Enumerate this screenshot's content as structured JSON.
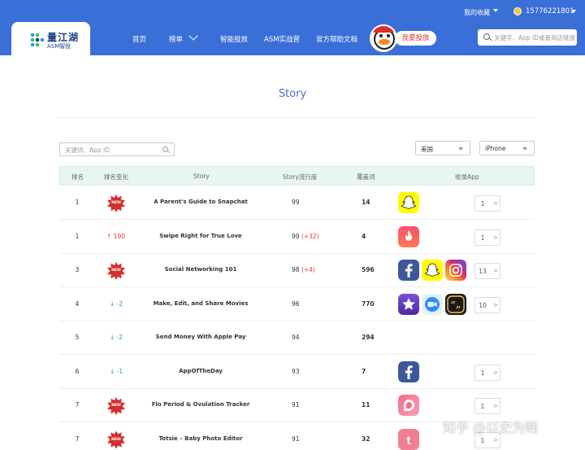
{
  "header": {
    "logo_name": "量江湖",
    "logo_sub": "ASM智投",
    "favorites": "我的收藏",
    "user_phone": "15776221801",
    "nav": [
      "首页",
      "榜单",
      "智能投放",
      "ASM实战营",
      "官方帮助文档"
    ],
    "promote_button": "我要投放",
    "search_placeholder": "关键字、App ID或者商店链接"
  },
  "page": {
    "title": "Story"
  },
  "filters": {
    "keyword_placeholder": "关键词、App ID",
    "country": "美国",
    "device": "iPhone"
  },
  "table": {
    "columns": [
      "排名",
      "排名变化",
      "Story",
      "Story流行度",
      "覆盖词",
      "收录App"
    ],
    "new_badge": "NEW",
    "rows": [
      {
        "rank": "1",
        "change": "new",
        "change_text": "",
        "story": "A Parent's Guide to Snapchat",
        "pop": "99",
        "pop_delta": "",
        "cover": "14",
        "apps": [
          "snapchat"
        ],
        "page": "1",
        "next": ">"
      },
      {
        "rank": "1",
        "change": "up",
        "change_text": "↑ 190",
        "story": "Swipe Right for True Love",
        "pop": "99",
        "pop_delta": "(+32)",
        "cover": "4",
        "apps": [
          "tinder"
        ],
        "page": "1",
        "next": ">"
      },
      {
        "rank": "3",
        "change": "new",
        "change_text": "",
        "story": "Social Networking 101",
        "pop": "98",
        "pop_delta": "(+4)",
        "cover": "596",
        "apps": [
          "facebook",
          "snapchat",
          "instagram"
        ],
        "page": "13",
        "next": ">"
      },
      {
        "rank": "4",
        "change": "down",
        "change_text": "↓ -2",
        "story": "Make, Edit, and Share Movies",
        "pop": "96",
        "pop_delta": "",
        "cover": "770",
        "apps": [
          "imovie",
          "zoom",
          "quotes"
        ],
        "page": "10",
        "next": ">"
      },
      {
        "rank": "5",
        "change": "down",
        "change_text": "↓ -2",
        "story": "Send Money With Apple Pay",
        "pop": "94",
        "pop_delta": "",
        "cover": "294",
        "apps": [],
        "page": "",
        "next": ""
      },
      {
        "rank": "6",
        "change": "down",
        "change_text": "↓ -1",
        "story": "AppOfTheDay",
        "pop": "93",
        "pop_delta": "",
        "cover": "7",
        "apps": [
          "facebook"
        ],
        "page": "1",
        "next": ">"
      },
      {
        "rank": "7",
        "change": "new",
        "change_text": "",
        "story": "Flo Period & Ovulation Tracker",
        "pop": "91",
        "pop_delta": "",
        "cover": "11",
        "apps": [
          "flo"
        ],
        "page": "1",
        "next": ">"
      },
      {
        "rank": "7",
        "change": "new",
        "change_text": "",
        "story": "Totsie – Baby Photo Editor",
        "pop": "91",
        "pop_delta": "",
        "cover": "32",
        "apps": [
          "totsie"
        ],
        "page": "1",
        "next": ">"
      }
    ]
  },
  "colors": {
    "header_bg": "#3b6fd8",
    "table_header_bg": "#e9f6ef",
    "up": "#e53935",
    "down": "#2e9e4c"
  },
  "watermark": "知乎 @以史为贱"
}
